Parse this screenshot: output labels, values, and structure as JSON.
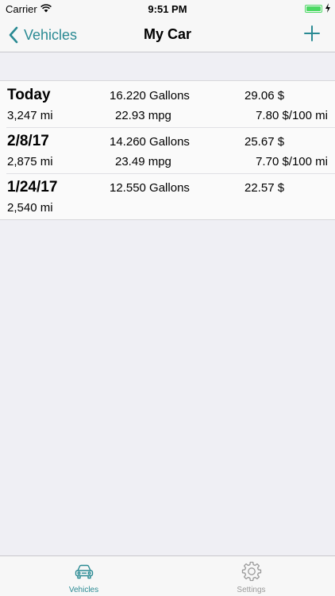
{
  "status_bar": {
    "carrier": "Carrier",
    "time": "9:51 PM"
  },
  "nav": {
    "back_label": "Vehicles",
    "title": "My Car"
  },
  "fillups": [
    {
      "date": "Today",
      "miles": "3,247 mi",
      "gallons": "16.220 Gallons",
      "mpg": "22.93 mpg",
      "cost": "29.06 $",
      "cost_per_100": "7.80 $/100 mi"
    },
    {
      "date": "2/8/17",
      "miles": "2,875 mi",
      "gallons": "14.260 Gallons",
      "mpg": "23.49 mpg",
      "cost": "25.67 $",
      "cost_per_100": "7.70 $/100 mi"
    },
    {
      "date": "1/24/17",
      "miles": "2,540 mi",
      "gallons": "12.550 Gallons",
      "mpg": "",
      "cost": "22.57 $",
      "cost_per_100": ""
    }
  ],
  "tabs": [
    {
      "label": "Vehicles",
      "icon": "car-icon",
      "selected": true
    },
    {
      "label": "Settings",
      "icon": "gear-icon",
      "selected": false
    }
  ],
  "colors": {
    "accent": "#2a8a93",
    "battery": "#4cd964",
    "inactive_tab": "#999999"
  }
}
